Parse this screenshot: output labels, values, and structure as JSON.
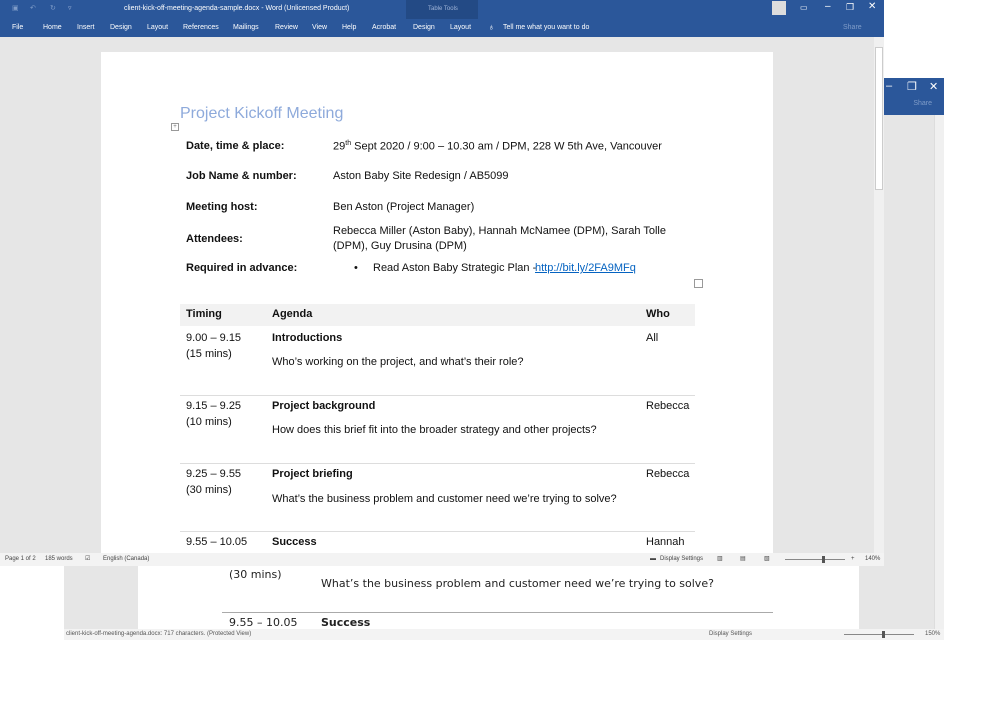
{
  "back_window": {
    "share": "Share",
    "rows": [
      {
        "timing2": "(30 mins)",
        "desc": "What’s the business problem and customer need we’re trying to solve?"
      },
      {
        "timing": "9.55 – 10.05",
        "title": "Success"
      }
    ],
    "status": "client-kick-off-meeting-agenda.docx: 717 characters.  (Protected View)",
    "display_settings": "Display Settings",
    "zoom": "150%",
    "zoom_level": 150
  },
  "titlebar": {
    "title": "client-kick-off-meeting-agenda-sample.docx  -  Word (Unlicensed Product)",
    "context": "Table Tools"
  },
  "ribbon": {
    "tabs": [
      "File",
      "Home",
      "Insert",
      "Design",
      "Layout",
      "References",
      "Mailings",
      "Review",
      "View",
      "Help",
      "Acrobat",
      "Design",
      "Layout"
    ],
    "tell_me": "Tell me what you want to do",
    "share": "Share"
  },
  "document": {
    "heading": "Project Kickoff Meeting",
    "info": [
      {
        "label": "Date, time & place:",
        "value_pre": "29",
        "value_sup": "th",
        "value": " Sept 2020 / 9:00 – 10.30 am / DPM, 228 W 5th Ave, Vancouver"
      },
      {
        "label": "Job Name & number:",
        "value": "Aston Baby Site Redesign / AB5099"
      },
      {
        "label": "Meeting host:",
        "value": "Ben Aston (Project Manager)"
      },
      {
        "label": "Attendees:",
        "value": "Rebecca Miller (Aston Baby), Hannah McNamee (DPM), Sarah Tolle",
        "value2": "(DPM), Guy Drusina (DPM)"
      },
      {
        "label": "Required in advance:",
        "value": "Read Aston Baby Strategic Plan - ",
        "link": "http://bit.ly/2FA9MFq"
      }
    ],
    "table_headers": [
      "Timing",
      "Agenda",
      "Who"
    ],
    "rows": [
      {
        "timing": "9.00 – 9.15",
        "duration": "(15 mins)",
        "title": "Introductions",
        "desc": "Who’s working on the project, and what’s their role?",
        "who": "All"
      },
      {
        "timing": "9.15 – 9.25",
        "duration": "(10 mins)",
        "title": "Project background",
        "desc": "How does this brief fit into the broader strategy and other projects?",
        "who": "Rebecca"
      },
      {
        "timing": "9.25 – 9.55",
        "duration": "(30 mins)",
        "title": "Project briefing",
        "desc": "What’s the business problem and customer need we’re trying to solve?",
        "who": "Rebecca"
      },
      {
        "timing": "9.55 – 10.05",
        "title": "Success",
        "who": "Hannah"
      }
    ]
  },
  "status": {
    "page": "Page 1 of 2",
    "words": "185 words",
    "language": "English (Canada)",
    "display_settings": "Display Settings",
    "zoom": "140%",
    "zoom_level": 140
  },
  "colors": {
    "ribbon": "#2b579a",
    "heading": "#8eaadb",
    "link": "#0563c1"
  }
}
